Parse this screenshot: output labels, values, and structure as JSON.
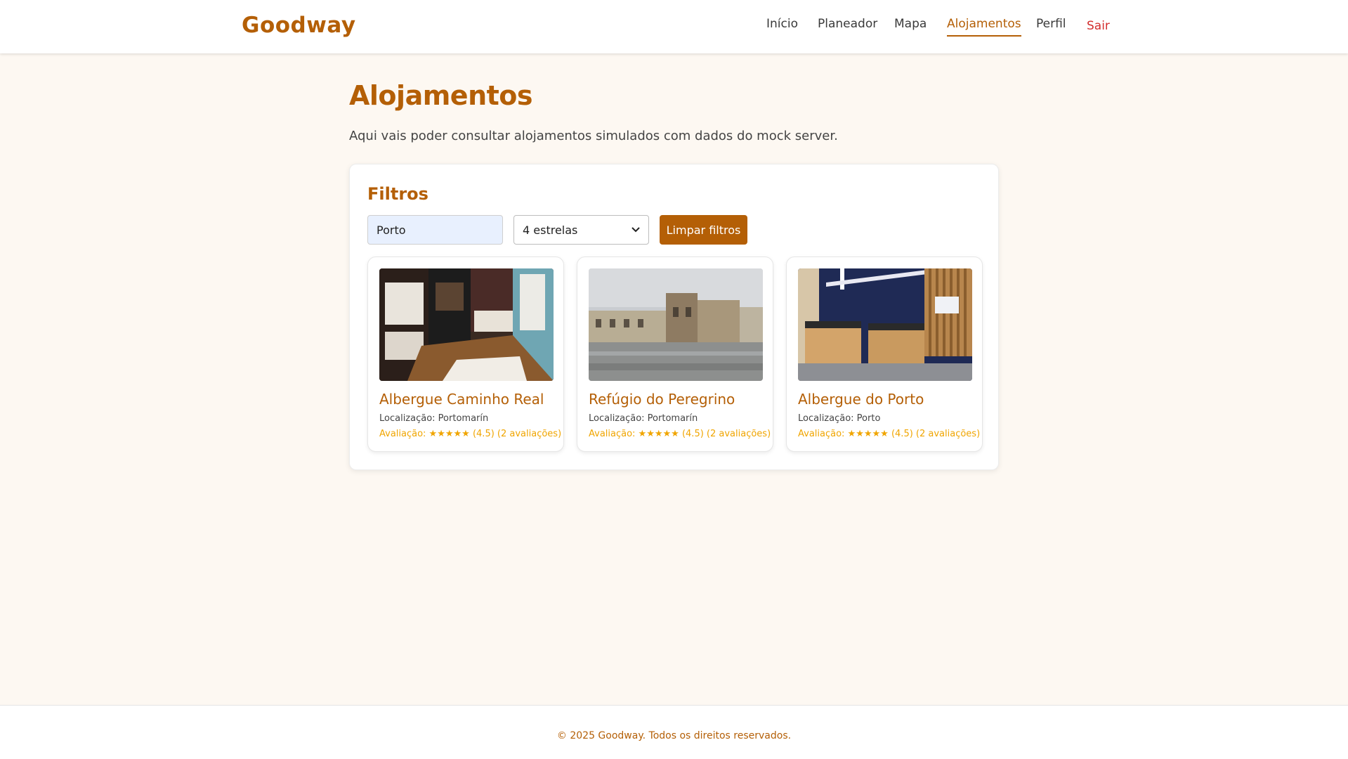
{
  "header": {
    "brand": "Goodway",
    "nav": [
      {
        "label": "Início"
      },
      {
        "label": "Planeador"
      },
      {
        "label": "Mapa"
      },
      {
        "label": "Alojamentos",
        "active": true
      },
      {
        "label": "Perfil"
      }
    ],
    "logout_label": "Sair"
  },
  "main": {
    "title": "Alojamentos",
    "subtitle": "Aqui vais poder consultar alojamentos simulados com dados do mock server."
  },
  "filters": {
    "title": "Filtros",
    "search_value": "Porto",
    "stars_selected": "4 estrelas",
    "clear_label": "Limpar filtros"
  },
  "cards": [
    {
      "name": "Albergue Caminho Real",
      "location": "Localização: Portomarín",
      "rating": "Avaliação: ★★★★★ (4.5) (2 avaliações)"
    },
    {
      "name": "Refúgio do Peregrino",
      "location": "Localização: Portomarín",
      "rating": "Avaliação: ★★★★★ (4.5) (2 avaliações)"
    },
    {
      "name": "Albergue do Porto",
      "location": "Localização: Porto",
      "rating": "Avaliação: ★★★★★ (4.5) (2 avaliações)"
    }
  ],
  "footer": {
    "text": "© 2025 Goodway. Todos os direitos reservados."
  },
  "colors": {
    "accent": "#b45f06",
    "background": "#fdf8f2",
    "rating": "#f0a500",
    "logout": "#d32f2f"
  }
}
